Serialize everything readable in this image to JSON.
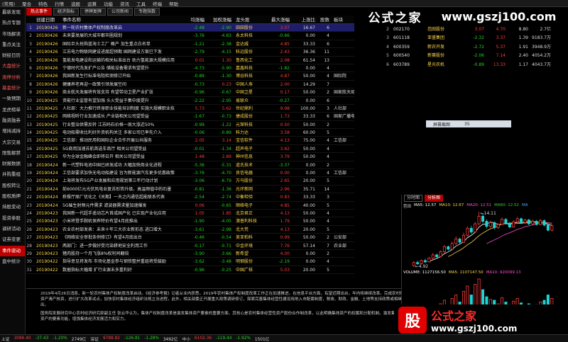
{
  "menu": [
    "(常用)",
    "聚合",
    "特色",
    "行情",
    "选股",
    "运算",
    "功能",
    "资讯",
    "工具",
    "终端",
    "帮助"
  ],
  "leftnav": [
    {
      "label": "最新发现",
      "style": "normal"
    },
    {
      "label": "热点专题",
      "style": "normal"
    },
    {
      "label": "市场解读",
      "style": "normal"
    },
    {
      "label": "重点关注",
      "style": "normal"
    },
    {
      "label": "财经日历",
      "style": "normal"
    },
    {
      "label": "大盘统计",
      "style": "red"
    },
    {
      "label": "涨停分析",
      "style": "red"
    },
    {
      "label": "基金统计",
      "style": "red"
    },
    {
      "label": "一致预期",
      "style": "normal"
    },
    {
      "label": "龙虎榜单",
      "style": "normal"
    },
    {
      "label": "融资融券",
      "style": "normal"
    },
    {
      "label": "增持减持",
      "style": "normal"
    },
    {
      "label": "大宗交易",
      "style": "normal"
    },
    {
      "label": "限售解禁",
      "style": "normal"
    },
    {
      "label": "财报数据",
      "style": "normal"
    },
    {
      "label": "并购重组",
      "style": "normal"
    },
    {
      "label": "股权转让",
      "style": "normal"
    },
    {
      "label": "股权质押",
      "style": "normal"
    },
    {
      "label": "持股变动",
      "style": "normal"
    },
    {
      "label": "投资参股",
      "style": "normal"
    },
    {
      "label": "调研活动",
      "style": "normal"
    },
    {
      "label": "证券变更",
      "style": "normal"
    },
    {
      "label": "事件驱动",
      "style": "active"
    },
    {
      "label": "盘中统计",
      "style": "normal"
    }
  ],
  "tabs": [
    {
      "label": "热点事件",
      "active": true
    },
    {
      "label": "经济指标",
      "active": false
    },
    {
      "label": "停牌复牌",
      "active": false
    },
    {
      "label": "公司新闻",
      "active": false
    },
    {
      "label": "专题指数",
      "active": false
    }
  ],
  "table": {
    "headers": [
      "",
      "创建日期",
      "事件名称",
      "均涨幅",
      "加权涨幅",
      "龙头股",
      "最大涨幅",
      "上涨比",
      "股数",
      "板块"
    ],
    "rows": [
      {
        "n": "1",
        "date": "20190426",
        "name": "新一轮农村集体产权制度改革启",
        "avg": "-2.48",
        "wavg": "-2.90",
        "leader": "田田股份",
        "max": "3.07",
        "ratio": "16.67",
        "cnt": "6",
        "board": ""
      },
      {
        "n": "2",
        "date": "20190426",
        "name": "未来要发展的大城市都市圈规划",
        "avg": "-3.76",
        "wavg": "-4.83",
        "leader": "永太科技",
        "max": "-0.66",
        "ratio": "0.00",
        "cnt": "4",
        "board": ""
      },
      {
        "n": "3",
        "date": "20190426",
        "name": "国际巨头抢购蓝海士工厂 概产 加生重点白名单",
        "avg": "-1.21",
        "wavg": "-2.38",
        "leader": "金达威",
        "max": "4.85",
        "ratio": "33.33",
        "cnt": "6",
        "board": ""
      },
      {
        "n": "4",
        "date": "20190426",
        "name": "江苏电力物联网建设进度超预期 国网建设方案已下发",
        "avg": "-2.79",
        "wavg": "-4.15",
        "leader": "科远股份",
        "max": "2.43",
        "ratio": "36.36",
        "cnt": "11",
        "board": ""
      },
      {
        "n": "5",
        "date": "20190426",
        "name": "氢能发电建设和运输的相关标准出台 助力氢能源大规模应用",
        "avg": "0.01",
        "wavg": "1.30",
        "leader": "鲁西化工",
        "max": "2.08",
        "ratio": "61.54",
        "cnt": "13",
        "board": ""
      },
      {
        "n": "6",
        "date": "20190426",
        "name": "宁德时代洗发扩产公告 储能设备需求有望提升",
        "avg": "-4.73",
        "wavg": "-5.90",
        "leader": "嘉鑫科技",
        "max": "-1.82",
        "ratio": "0.00",
        "cnt": "4",
        "board": ""
      },
      {
        "n": "7",
        "date": "20190426",
        "name": "我国新发生行标准电阻检测修订开始",
        "avg": "-0.89",
        "wavg": "-1.30",
        "leader": "博谷科技",
        "max": "4.87",
        "ratio": "50.00",
        "cnt": "4",
        "board": "国际院"
      },
      {
        "n": "8",
        "date": "20190426",
        "name": "健康养老再迎一政策引领发展空间",
        "avg": "-0.73",
        "wavg": "0.23",
        "leader": "中国人寿",
        "max": "2.00",
        "ratio": "14.29",
        "cnt": "7",
        "board": ""
      },
      {
        "n": "9",
        "date": "20190426",
        "name": "商业航天发展将有效支持 有望带动卫星产业扩张",
        "avg": "-0.96",
        "wavg": "-0.67",
        "leader": "中国卫星",
        "max": "0.17",
        "ratio": "50.00",
        "cnt": "2",
        "board": "国家航天局"
      },
      {
        "n": "10",
        "date": "20190425",
        "name": "资能行业监管有望加强 头火受益于集中度提升",
        "avg": "-2.22",
        "wavg": "-2.95",
        "leader": "易联众",
        "max": "-0.27",
        "ratio": "0.00",
        "cnt": "6",
        "board": ""
      },
      {
        "n": "11",
        "date": "20190425",
        "name": "人社部：大力推行终身职业技能培训制度 实施大规模职业技",
        "avg": "5.73",
        "wavg": "5.62",
        "leader": "世纪鼎利",
        "max": "9.98",
        "ratio": "100.00",
        "cnt": "3",
        "board": "人社部"
      },
      {
        "n": "12",
        "date": "20190425",
        "name": "网络视听行业加速成长 产业链相关公司望受益",
        "avg": "-1.67",
        "wavg": "-0.73",
        "leader": "捷成股份",
        "max": "1.73",
        "ratio": "33.33",
        "cnt": "6",
        "board": "国家广播电视"
      },
      {
        "n": "13",
        "date": "20190425",
        "name": "行业整治供需反转 江苏码石价格一周大涨近50%",
        "avg": "-0.99",
        "wavg": "-1.22",
        "leader": "元琛科技",
        "max": "0.50",
        "ratio": "50.00",
        "cnt": "2",
        "board": ""
      },
      {
        "n": "14",
        "date": "20190425",
        "name": "电动船需收比利好外资机构关注 多家公司已率先介入",
        "avg": "-0.06",
        "wavg": "-0.89",
        "leader": "科力达",
        "max": "3.58",
        "ratio": "60.00",
        "cnt": "5",
        "board": ""
      },
      {
        "n": "15",
        "date": "20190425",
        "name": "工信部：推动民用和国际企业合作开展公共服务",
        "avg": "2.05",
        "wavg": "3.14",
        "leader": "宝信软件",
        "max": "4.13",
        "ratio": "75.00",
        "cnt": "4",
        "board": "工信部"
      },
      {
        "n": "16",
        "date": "20190425",
        "name": "5G商用加速苏航首选车商厅 相关公司望受益",
        "avg": "-0.01",
        "wavg": "-1.34",
        "leader": "超声电子",
        "max": "3.62",
        "ratio": "50.00",
        "cnt": "4",
        "board": ""
      },
      {
        "n": "17",
        "date": "20190425",
        "name": "华为全球金融峰会即将召开 相关公司望受益",
        "avg": "1.48",
        "wavg": "2.89",
        "leader": "神州信息",
        "max": "3.79",
        "ratio": "50.00",
        "cnt": "4",
        "board": ""
      },
      {
        "n": "18",
        "date": "20190424",
        "name": "新一代塑料电池中国已研发成功 大幅加快商业化进程",
        "avg": "-5.36",
        "wavg": "-5.31",
        "leader": "道氏技术",
        "max": "-3.37",
        "ratio": "0.00",
        "cnt": "2",
        "board": ""
      },
      {
        "n": "19",
        "date": "20190424",
        "name": "工信部要求加快无电动船建设 旨为新能源汽车更多优惠政策",
        "avg": "-3.76",
        "wavg": "-4.70",
        "leader": "良信电器",
        "max": "0.00",
        "ratio": "0.00",
        "cnt": "4",
        "board": "工信部"
      },
      {
        "n": "20",
        "date": "20190424",
        "name": "上海将发布5G产业发展和应用规划第三年行动计划",
        "avg": "-3.06",
        "wavg": "-6.79",
        "leader": "万马股份",
        "max": "2.65",
        "ratio": "20.00",
        "cnt": "5",
        "board": ""
      },
      {
        "n": "21",
        "date": "20190424",
        "name": "前6000亿元光伏风电业复苏形势升级，高温频值中的石墨",
        "avg": "-0.81",
        "wavg": "-1.36",
        "leader": "光环新网",
        "max": "2.96",
        "ratio": "35.71",
        "cnt": "14",
        "board": ""
      },
      {
        "n": "22",
        "date": "20190424",
        "name": "秩餐厅原厂优化之《关期】一天之内通信超能联系代表",
        "avg": "-2.54",
        "wavg": "-2.74",
        "leader": "中衡检验",
        "max": "0.83",
        "ratio": "33.33",
        "cnt": "3",
        "board": ""
      },
      {
        "n": "23",
        "date": "20190424",
        "name": "5G催生射频元件需求 滤波器需求量加速爆发",
        "avg": "0.06",
        "wavg": "-0.65",
        "leader": "顺络电子",
        "max": "4.85",
        "ratio": "40.00",
        "cnt": "5",
        "board": ""
      },
      {
        "n": "24",
        "date": "20190423",
        "name": "我国新一代超手遥动芯片首成国产化 已实现产业化应用",
        "avg": "1.05",
        "wavg": "1.85",
        "leader": "北京君正",
        "max": "4.13",
        "ratio": "50.00",
        "cnt": "4",
        "board": ""
      },
      {
        "n": "25",
        "date": "20190423",
        "name": "小米将登手腕机保养特价有望4月底推出",
        "avg": "-1.90",
        "wavg": "-4.05",
        "leader": "澳普利科技",
        "max": "1.79",
        "ratio": "50.00",
        "cnt": "4",
        "board": ""
      },
      {
        "n": "26",
        "date": "20190423",
        "name": "农业农村部发表：未来十年三大农业新形态 进口增大",
        "avg": "-3.61",
        "wavg": "-2.98",
        "leader": "北大荒",
        "max": "4.13",
        "ratio": "20.00",
        "cnt": "5",
        "board": ""
      },
      {
        "n": "27",
        "date": "20190423",
        "name": "《网络安全审批条例修订》有望4月底出台",
        "avg": "-0.46",
        "wavg": "-0.54",
        "leader": "美亚柏科",
        "max": "0.99",
        "ratio": "50.00",
        "cnt": "2",
        "board": "公安部"
      },
      {
        "n": "28",
        "date": "20190423",
        "name": "两部门：进一步做好受污染耕地安全利用工作",
        "avg": "-0.17",
        "wavg": "-0.71",
        "leader": "中金环境",
        "max": "7.76",
        "ratio": "57.14",
        "cnt": "7",
        "board": "农业部"
      },
      {
        "n": "29",
        "date": "20190423",
        "name": "猪肉股持一个月飞涨8%权利同翻倍",
        "avg": "-3.90",
        "wavg": "-3.66",
        "leader": "新希望",
        "max": "4.00",
        "ratio": "0.00",
        "cnt": "2",
        "board": ""
      },
      {
        "n": "30",
        "date": "20190422",
        "name": "指导意见将发布 市场化基金参与钢铁整并重组将受鼓励",
        "avg": "-3.62",
        "wavg": "-3.48",
        "leader": "明钢股份",
        "max": "-2.19",
        "ratio": "0.00",
        "cnt": "4",
        "board": ""
      },
      {
        "n": "31",
        "date": "20190422",
        "name": "数据指标大幅增 扩行业源末多重利好",
        "avg": "-0.96",
        "wavg": "-0.25",
        "leader": "中国广核",
        "max": "5.03",
        "ratio": "20.00",
        "cnt": "5",
        "board": ""
      }
    ]
  },
  "article": {
    "p1": "2019年4月26日消息，新一轮农村集体产权制度改革启动。《经济参考报》记者从业内获悉，2019年农村集体产权制度改革工作正在加速推进，在信息平台方面，有望近期出台，年内将继续改革。完成农村集体资产清产核资，进行扩大改革试点，加快农村集体经济组织法规立法进程，此外，相关部委正开展重大政策调研修订，探索完善集体经营性建设用地入市配套制度，税收、财政、金融、土地等支持政策或相继推出。",
    "p2": "国务院发展研究中心农村经济研究部副主任 张云华认为，集体产权制度改革是激发集体资产要素的重要方面，其核心是农村集体经营性资产股份合作制改革，以此明确集体资产的权属和分配机制。激发集体经营性资产的要素功能，增强集体经济发展活力和实力。"
  },
  "right_table": {
    "rows": [
      {
        "n": "2",
        "code": "002170",
        "name": "芭田股份",
        "p": "3.07",
        "c": "4.70",
        "a": "8.80",
        "b": "2.7亿"
      },
      {
        "n": "3",
        "code": "601118",
        "name": "亚盛集团",
        "p": "-2.32",
        "c": "3.37",
        "a": "1.39",
        "b": "9183.7万"
      },
      {
        "n": "4",
        "code": "600359",
        "name": "新农开发",
        "p": "-2.72",
        "c": "5.37",
        "a": "1.91",
        "b": "3948.9万"
      },
      {
        "n": "5",
        "code": "600540",
        "name": "新赛股份",
        "p": "-2.06",
        "c": "7.14",
        "a": "2.40",
        "b": "4054.2万"
      },
      {
        "n": "6",
        "code": "603789",
        "name": "星光农机",
        "p": "-0.89",
        "c": "13.33",
        "a": "1.17",
        "b": "4043.7万"
      }
    ]
  },
  "watermark": {
    "cn": "公式之家",
    "url": "www.gszj100.com"
  },
  "sector_bar": {
    "label": "屏幕截图",
    "value": "35"
  },
  "kline": {
    "tabs": [
      {
        "label": "分时图",
        "active": false
      },
      {
        "label": "分析图",
        "active": true
      }
    ],
    "title": "芭田",
    "ma_labels": [
      {
        "t": "MA5: 12.57",
        "c": "#ffffff"
      },
      {
        "t": "MA10: 12.67",
        "c": "#ffd84a"
      },
      {
        "t": "MA20: 12.51",
        "c": "#ff4fd0"
      },
      {
        "t": "MA60: 12.52",
        "c": "#30d030"
      },
      {
        "t": "MA",
        "c": "#4aa8ff"
      }
    ],
    "high_label": "14.11",
    "low_label": "4.92",
    "vol_labels": [
      {
        "t": "VOLUME: 1127156.50",
        "c": "#ffffff"
      },
      {
        "t": "MA5: 1107147.50",
        "c": "#ffd84a"
      },
      {
        "t": "MA10: 920099.13",
        "c": "#ff4fd0"
      }
    ],
    "candles": [
      {
        "o": 5.6,
        "c": 6.1,
        "h": 6.3,
        "l": 5.4,
        "v": 12
      },
      {
        "o": 6.1,
        "c": 5.9,
        "h": 6.4,
        "l": 5.7,
        "v": 10
      },
      {
        "o": 5.9,
        "c": 6.4,
        "h": 6.6,
        "l": 5.8,
        "v": 14
      },
      {
        "o": 6.4,
        "c": 6.2,
        "h": 6.7,
        "l": 6.0,
        "v": 11
      },
      {
        "o": 6.2,
        "c": 6.8,
        "h": 7.0,
        "l": 6.1,
        "v": 16
      },
      {
        "o": 6.8,
        "c": 7.3,
        "h": 7.6,
        "l": 6.6,
        "v": 18
      },
      {
        "o": 7.3,
        "c": 7.0,
        "h": 7.5,
        "l": 6.8,
        "v": 13
      },
      {
        "o": 7.0,
        "c": 7.8,
        "h": 8.0,
        "l": 6.9,
        "v": 20
      },
      {
        "o": 7.8,
        "c": 8.6,
        "h": 8.9,
        "l": 7.6,
        "v": 24
      },
      {
        "o": 8.6,
        "c": 8.2,
        "h": 8.8,
        "l": 8.0,
        "v": 18
      },
      {
        "o": 8.2,
        "c": 9.1,
        "h": 9.4,
        "l": 8.1,
        "v": 26
      },
      {
        "o": 9.1,
        "c": 9.8,
        "h": 10.2,
        "l": 8.9,
        "v": 30
      },
      {
        "o": 9.8,
        "c": 9.3,
        "h": 10.0,
        "l": 9.0,
        "v": 22
      },
      {
        "o": 9.3,
        "c": 10.4,
        "h": 10.8,
        "l": 9.2,
        "v": 34
      },
      {
        "o": 10.4,
        "c": 11.5,
        "h": 11.8,
        "l": 10.2,
        "v": 40
      },
      {
        "o": 11.5,
        "c": 10.9,
        "h": 11.9,
        "l": 10.6,
        "v": 30
      },
      {
        "o": 10.9,
        "c": 12.2,
        "h": 12.5,
        "l": 10.8,
        "v": 42
      },
      {
        "o": 12.2,
        "c": 13.4,
        "h": 14.11,
        "l": 12.0,
        "v": 48
      },
      {
        "o": 13.4,
        "c": 12.6,
        "h": 13.8,
        "l": 12.3,
        "v": 36
      },
      {
        "o": 12.6,
        "c": 11.8,
        "h": 12.9,
        "l": 11.5,
        "v": 28
      },
      {
        "o": 11.8,
        "c": 12.4,
        "h": 12.7,
        "l": 11.6,
        "v": 25
      },
      {
        "o": 12.4,
        "c": 11.6,
        "h": 12.6,
        "l": 11.3,
        "v": 24
      },
      {
        "o": 11.6,
        "c": 12.1,
        "h": 12.3,
        "l": 11.4,
        "v": 20
      },
      {
        "o": 12.1,
        "c": 12.9,
        "h": 13.2,
        "l": 12.0,
        "v": 27
      },
      {
        "o": 12.9,
        "c": 12.3,
        "h": 13.1,
        "l": 12.1,
        "v": 22
      },
      {
        "o": 12.3,
        "c": 11.7,
        "h": 12.5,
        "l": 11.5,
        "v": 19
      },
      {
        "o": 11.7,
        "c": 12.5,
        "h": 12.8,
        "l": 11.6,
        "v": 23
      },
      {
        "o": 12.5,
        "c": 13.0,
        "h": 13.3,
        "l": 12.3,
        "v": 26
      },
      {
        "o": 13.0,
        "c": 12.4,
        "h": 13.2,
        "l": 12.2,
        "v": 21
      },
      {
        "o": 12.4,
        "c": 12.8,
        "h": 13.0,
        "l": 12.2,
        "v": 18
      },
      {
        "o": 12.8,
        "c": 12.2,
        "h": 13.0,
        "l": 12.0,
        "v": 20
      },
      {
        "o": 12.2,
        "c": 12.6,
        "h": 12.9,
        "l": 12.0,
        "v": 17
      },
      {
        "o": 12.6,
        "c": 12.1,
        "h": 12.8,
        "l": 11.9,
        "v": 19
      },
      {
        "o": 12.1,
        "c": 12.7,
        "h": 13.0,
        "l": 12.0,
        "v": 22
      },
      {
        "o": 12.7,
        "c": 12.0,
        "h": 12.9,
        "l": 11.8,
        "v": 24
      },
      {
        "o": 12.0,
        "c": 11.2,
        "h": 12.2,
        "l": 11.0,
        "v": 30
      },
      {
        "o": 11.2,
        "c": 11.9,
        "h": 12.1,
        "l": 11.0,
        "v": 26
      }
    ]
  },
  "bottom_logo": {
    "badge": "股",
    "cn": "公式之家",
    "url": "www.gszj100.com"
  },
  "statusbar": [
    {
      "t": "上证",
      "c": "swht"
    },
    {
      "t": "3086.40",
      "c": "sred"
    },
    {
      "t": "-37.43",
      "c": "sgrn"
    },
    {
      "t": "-1.20%",
      "c": "sgrn"
    },
    {
      "t": "2749亿",
      "c": "swht"
    },
    {
      "t": "深证",
      "c": "swht"
    },
    {
      "t": "9788.82",
      "c": "sred"
    },
    {
      "t": "-126.81",
      "c": "sgrn"
    },
    {
      "t": "-1.28%",
      "c": "sgrn"
    },
    {
      "t": "3492亿",
      "c": "swht"
    },
    {
      "t": "中小",
      "c": "swht"
    },
    {
      "t": "6102.36",
      "c": "sred"
    },
    {
      "t": "-119.44",
      "c": "sgrn"
    },
    {
      "t": "-1.92%",
      "c": "sgrn"
    },
    {
      "t": "1501亿",
      "c": "swht"
    }
  ]
}
